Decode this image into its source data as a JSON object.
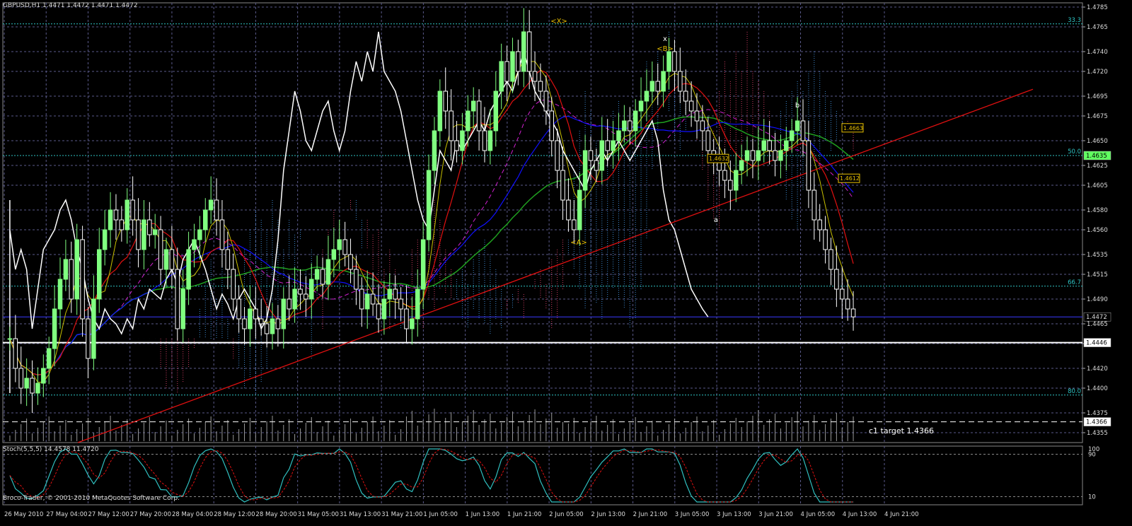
{
  "header": {
    "symbol_line": "GBPUSD,H1  1.4471 1.4472 1.4471 1.4472"
  },
  "footer": {
    "copyright": "Broco-Trader, © 2001-2010 MetaQuotes Software Corp."
  },
  "stoch_title": "Stoch(5,5,5) 14.4578 11.4720",
  "colors": {
    "background": "#000000",
    "grid": "#5a5a8a",
    "bull_candle": "#80ff80",
    "bear_candle": "#ffffff",
    "fib_line": "#2ec4c4",
    "trendline": "#e01010",
    "kijun": "#e01010",
    "tenkan": "#c8c000",
    "senkou_span_b": "#1010ff",
    "ma_long": "#20a020",
    "chikou": "#ffffff",
    "magenta_ma": "#d020d0",
    "cloud_up": "#4aa8ff",
    "cloud_down": "#ff4a7a",
    "label_yellow": "#e8c000",
    "stoch_main": "#30c0c0",
    "stoch_signal": "#e01010"
  },
  "chart_data": {
    "type": "candlestick",
    "symbol": "GBPUSD",
    "timeframe": "H1",
    "ylim": [
      1.4345,
      1.4785
    ],
    "y_ticks": [
      "1.4785",
      "1.4765",
      "1.4740",
      "1.4720",
      "1.4695",
      "1.4675",
      "1.4650",
      "1.4625",
      "1.4605",
      "1.4580",
      "1.4560",
      "1.4535",
      "1.4515",
      "1.4490",
      "1.4465",
      "1.4445",
      "1.4420",
      "1.4400",
      "1.4375",
      "1.4355"
    ],
    "x_ticks": [
      "26 May 2010",
      "27 May 04:00",
      "27 May 12:00",
      "27 May 20:00",
      "28 May 04:00",
      "28 May 12:00",
      "28 May 20:00",
      "31 May 05:00",
      "31 May 13:00",
      "31 May 21:00",
      "1 Jun 05:00",
      "1 Jun 13:00",
      "1 Jun 21:00",
      "2 Jun 05:00",
      "2 Jun 13:00",
      "2 Jun 21:00",
      "3 Jun 05:00",
      "3 Jun 13:00",
      "3 Jun 21:00",
      "4 Jun 05:00",
      "4 Jun 13:00",
      "4 Jun 21:00"
    ],
    "fib_levels": [
      {
        "label": "33.3",
        "price": 1.4768
      },
      {
        "label": "50.0",
        "price": 1.4635
      },
      {
        "label": "66.7",
        "price": 1.4503
      },
      {
        "label": "80.0",
        "price": 1.4393
      }
    ],
    "price_tags": [
      {
        "text": "1.4635",
        "price": 1.4635,
        "style": "green"
      },
      {
        "text": "1.4472",
        "price": 1.4472,
        "style": "plain"
      },
      {
        "text": "1.4446",
        "price": 1.4446,
        "style": "white"
      },
      {
        "text": "1.4366",
        "price": 1.4366,
        "style": "white"
      }
    ],
    "horizontal_lines": [
      {
        "price": 1.4446,
        "style": "solid"
      },
      {
        "price": 1.4366,
        "style": "dashed"
      },
      {
        "price": 1.4472,
        "style": "thin"
      }
    ],
    "annotations": [
      {
        "text": "<X>",
        "color": "yellow"
      },
      {
        "text": "<B>",
        "color": "yellow"
      },
      {
        "text": "x",
        "color": "white"
      },
      {
        "text": "<A>",
        "color": "yellow"
      },
      {
        "text": "a",
        "color": "white"
      },
      {
        "text": "b",
        "color": "white"
      },
      {
        "text": "c1 target  1.4366",
        "color": "white"
      }
    ],
    "box_labels": [
      {
        "text": "1.4663",
        "price": 1.4663
      },
      {
        "text": "1.4632",
        "price": 1.4632
      },
      {
        "text": "1.4612",
        "price": 1.4612
      }
    ],
    "stoch_levels": [
      "100",
      "90",
      "10"
    ],
    "closes": [
      1.445,
      1.442,
      1.44,
      1.441,
      1.4395,
      1.4405,
      1.442,
      1.444,
      1.448,
      1.451,
      1.453,
      1.449,
      1.455,
      1.447,
      1.443,
      1.449,
      1.454,
      1.456,
      1.458,
      1.457,
      1.456,
      1.459,
      1.457,
      1.454,
      1.457,
      1.4555,
      1.456,
      1.452,
      1.454,
      1.452,
      1.446,
      1.45,
      1.454,
      1.455,
      1.456,
      1.458,
      1.459,
      1.457,
      1.454,
      1.452,
      1.449,
      1.447,
      1.446,
      1.448,
      1.447,
      1.4465,
      1.4455,
      1.447,
      1.446,
      1.449,
      1.448,
      1.45,
      1.4495,
      1.449,
      1.451,
      1.452,
      1.4505,
      1.453,
      1.454,
      1.455,
      1.4535,
      1.452,
      1.45,
      1.448,
      1.4495,
      1.4485,
      1.447,
      1.449,
      1.45,
      1.449,
      1.448,
      1.446,
      1.447,
      1.45,
      1.455,
      1.462,
      1.466,
      1.47,
      1.468,
      1.465,
      1.464,
      1.466,
      1.468,
      1.469,
      1.466,
      1.464,
      1.466,
      1.47,
      1.473,
      1.471,
      1.474,
      1.472,
      1.476,
      1.472,
      1.471,
      1.47,
      1.468,
      1.465,
      1.462,
      1.459,
      1.457,
      1.456,
      1.46,
      1.464,
      1.463,
      1.462,
      1.465,
      1.464,
      1.465,
      1.466,
      1.467,
      1.466,
      1.468,
      1.469,
      1.47,
      1.471,
      1.47,
      1.472,
      1.474,
      1.472,
      1.47,
      1.469,
      1.468,
      1.467,
      1.466,
      1.464,
      1.463,
      1.462,
      1.461,
      1.46,
      1.462,
      1.463,
      1.464,
      1.463,
      1.464,
      1.465,
      1.464,
      1.463,
      1.464,
      1.465,
      1.466,
      1.467,
      1.465,
      1.46,
      1.457,
      1.456,
      1.454,
      1.452,
      1.45,
      1.449,
      1.448,
      1.4472
    ]
  }
}
